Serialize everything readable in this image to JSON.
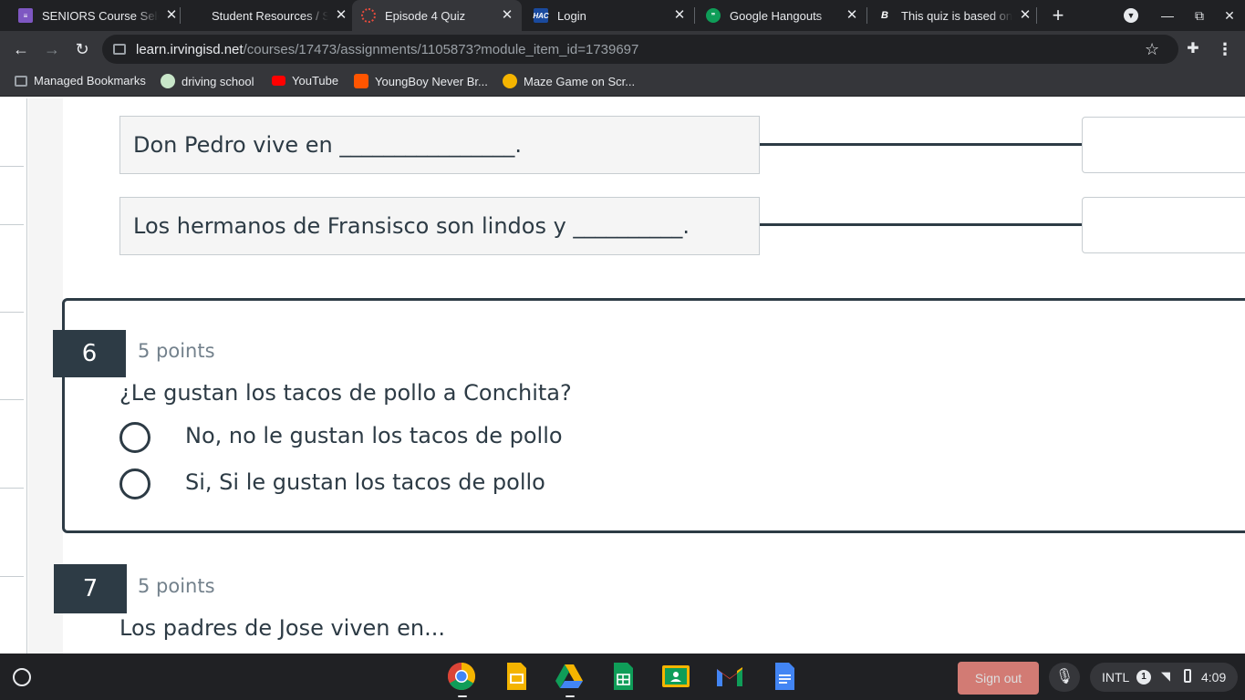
{
  "tabs": [
    {
      "title": "SENIORS Course Sele",
      "close": "✕",
      "color": "#7e57c2"
    },
    {
      "title": "Student Resources / S",
      "close": "✕",
      "color": "#35363a"
    },
    {
      "title": "Episode 4 Quiz",
      "close": "✕",
      "color": "#e94b3c"
    },
    {
      "title": "Login",
      "close": "✕",
      "color": "#1a4a9e",
      "badge": "HAC"
    },
    {
      "title": "Google Hangouts",
      "close": "✕",
      "color": "#0f9d58"
    },
    {
      "title": "This quiz is based on",
      "close": "✕",
      "color": "#202124",
      "badge": "B"
    }
  ],
  "toolbar": {
    "url_host": "learn.irvingisd.net",
    "url_path": "/courses/17473/assignments/1105873?module_item_id=1739697"
  },
  "bookmarks": [
    {
      "label": "Managed Bookmarks",
      "color": "#9aa0a6"
    },
    {
      "label": "driving school",
      "color": "#c8e6c9"
    },
    {
      "label": "YouTube",
      "color": "#ff0000"
    },
    {
      "label": "YoungBoy Never Br...",
      "color": "#ff5500"
    },
    {
      "label": "Maze Game on Scr...",
      "color": "#f4b400"
    }
  ],
  "matching": {
    "rows": [
      {
        "prompt": "Don Pedro vive en ________________."
      },
      {
        "prompt": "Los hermanos de Fransisco son lindos y __________."
      }
    ]
  },
  "question6": {
    "number": "6",
    "points": "5 points",
    "text": "¿Le gustan los tacos de pollo a Conchita?",
    "choices": [
      "No, no le gustan los tacos de pollo",
      "Si, Si le gustan los tacos de pollo"
    ]
  },
  "question7": {
    "number": "7",
    "points": "5 points",
    "text": "Los padres de Jose viven en..."
  },
  "shelf": {
    "apps": [
      "chrome-icon",
      "slides-icon",
      "drive-icon",
      "sheets-icon",
      "classroom-icon",
      "gmail-icon",
      "docs-icon"
    ],
    "signout_label": "Sign out",
    "ime": "INTL",
    "notification_count": "1",
    "clock": "4:09"
  }
}
